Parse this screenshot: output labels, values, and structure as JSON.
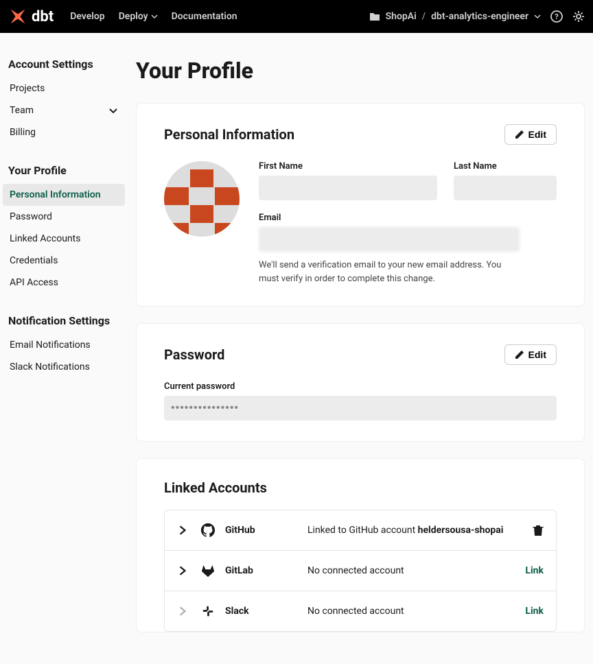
{
  "nav": {
    "brand": "dbt",
    "develop": "Develop",
    "deploy": "Deploy",
    "documentation": "Documentation",
    "project_folder": "ShopAi",
    "project_name": "dbt-analytics-engineer"
  },
  "sidebar": {
    "account_settings": "Account Settings",
    "projects": "Projects",
    "team": "Team",
    "billing": "Billing",
    "your_profile": "Your Profile",
    "personal_information": "Personal Information",
    "password": "Password",
    "linked_accounts": "Linked Accounts",
    "credentials": "Credentials",
    "api_access": "API Access",
    "notification_settings": "Notification Settings",
    "email_notifications": "Email Notifications",
    "slack_notifications": "Slack Notifications"
  },
  "main": {
    "title": "Your Profile",
    "edit": "Edit",
    "personal_info": {
      "heading": "Personal Information",
      "first_name_label": "First Name",
      "first_name_value": "",
      "last_name_label": "Last Name",
      "last_name_value": "",
      "email_label": "Email",
      "email_value": "",
      "email_help": "We'll send a verification email to your new email address. You must verify in order to complete this change."
    },
    "password": {
      "heading": "Password",
      "current_label": "Current password",
      "current_value": "•••••••••••••••"
    },
    "linked": {
      "heading": "Linked Accounts",
      "link_label": "Link",
      "github_name": "GitHub",
      "github_status_prefix": "Linked to GitHub account ",
      "github_account": "heldersousa-shopai",
      "gitlab_name": "GitLab",
      "gitlab_status": "No connected account",
      "slack_name": "Slack",
      "slack_status": "No connected account"
    }
  }
}
